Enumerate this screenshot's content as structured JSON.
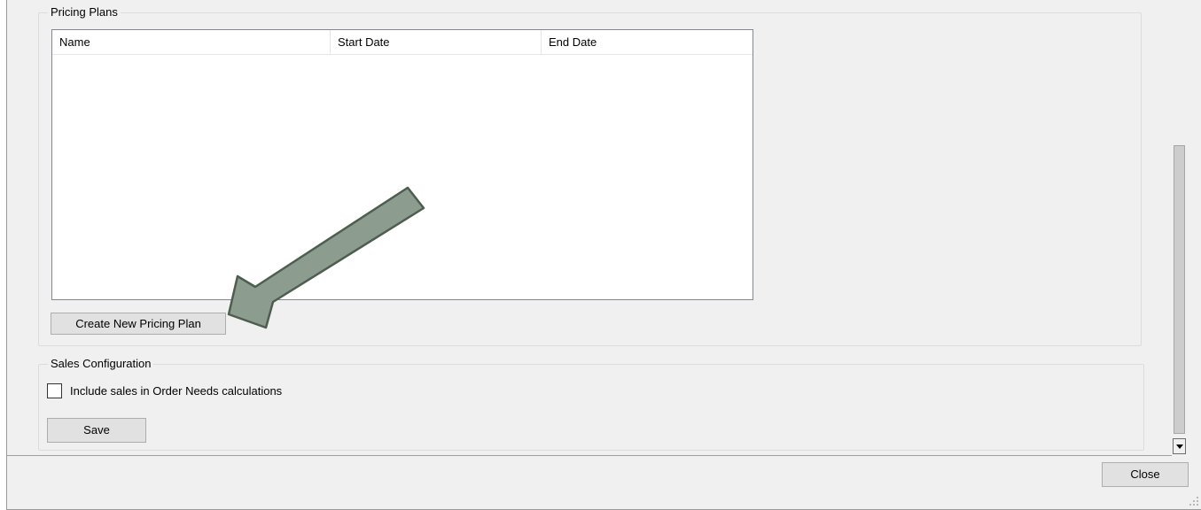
{
  "pricing_plans": {
    "group_label": "Pricing Plans",
    "columns": [
      "Name",
      "Start Date",
      "End Date"
    ],
    "rows": [],
    "create_button_label": "Create New Pricing Plan"
  },
  "sales_configuration": {
    "group_label": "Sales Configuration",
    "include_sales_label": "Include sales in Order Needs calculations",
    "include_sales_checked": false,
    "save_button_label": "Save"
  },
  "footer": {
    "close_button_label": "Close"
  },
  "annotation": {
    "arrow_color": "#8c9c8e",
    "arrow_outline": "#4d5e50"
  }
}
